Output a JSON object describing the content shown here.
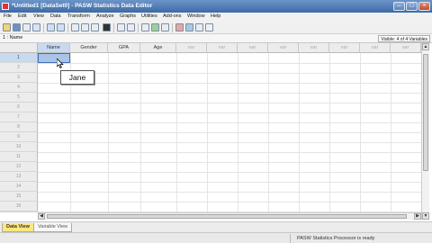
{
  "window": {
    "title": "*Untitled1 [DataSet0] - PASW Statistics Data Editor"
  },
  "menu": [
    "File",
    "Edit",
    "View",
    "Data",
    "Transform",
    "Analyze",
    "Graphs",
    "Utilities",
    "Add-ons",
    "Window",
    "Help"
  ],
  "toolbar": {
    "icons": [
      "open-icon",
      "save-icon",
      "print-icon",
      "dialog-recall-icon",
      "undo-icon",
      "redo-icon",
      "goto-case-icon",
      "goto-variable-icon",
      "variables-icon",
      "find-icon",
      "insert-cases-icon",
      "insert-variable-icon",
      "split-file-icon",
      "weight-cases-icon",
      "select-cases-icon",
      "value-labels-icon",
      "use-sets-icon",
      "show-all-variables-icon",
      "spelling-icon"
    ]
  },
  "cell_info": {
    "ref": "1 : Name",
    "visible": "Visible: 4 of 4 Variables"
  },
  "grid": {
    "columns": [
      "Name",
      "Gender",
      "GPA",
      "Age",
      "var",
      "var",
      "var",
      "var",
      "var",
      "var",
      "var",
      "var"
    ],
    "rows": [
      "1",
      "2",
      "3",
      "4",
      "5",
      "6",
      "7",
      "8",
      "9",
      "10",
      "11",
      "12",
      "13",
      "14",
      "15",
      "16"
    ],
    "row_partial": "17"
  },
  "tooltip": "Jane",
  "tabs": {
    "data_view": "Data View",
    "variable_view": "Variable View"
  },
  "status": "PASW Statistics  Processor is ready",
  "colors": {
    "selection": "#a9c4e8",
    "active_tab": "#ffe680",
    "titlebar": "#3e6aa6"
  }
}
